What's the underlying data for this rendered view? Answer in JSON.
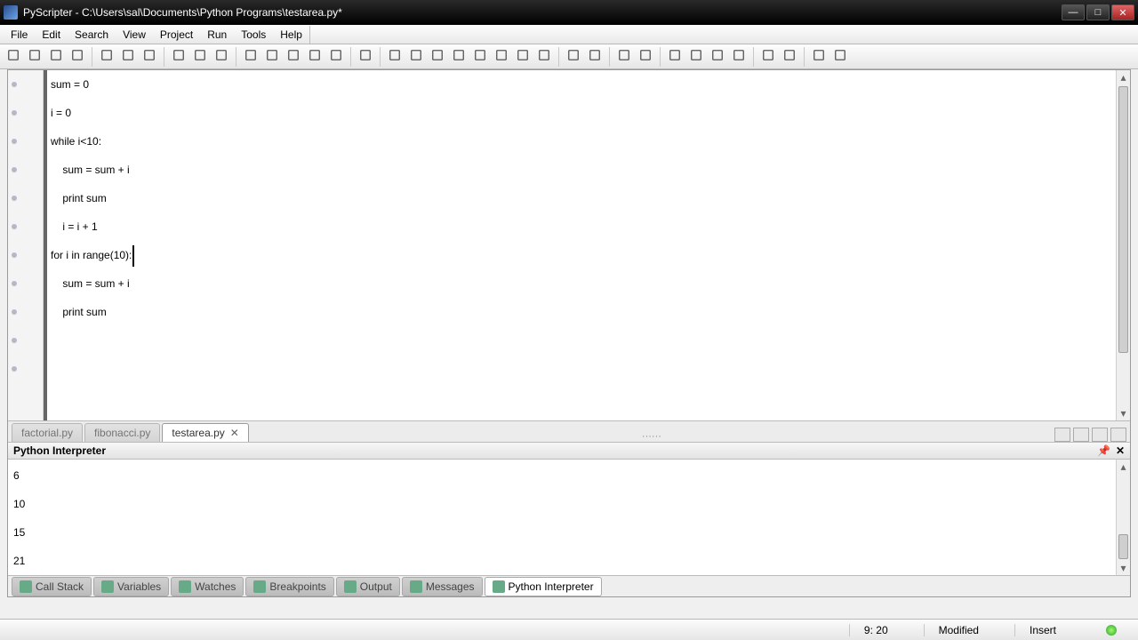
{
  "title": "PyScripter - C:\\Users\\sal\\Documents\\Python Programs\\testarea.py*",
  "menu": [
    "File",
    "Edit",
    "Search",
    "View",
    "Project",
    "Run",
    "Tools",
    "Help"
  ],
  "toolbar_icons": [
    "new-file",
    "open-file",
    "save",
    "save-all",
    "print",
    "cut",
    "copy",
    "paste",
    "reload",
    "stop-refresh",
    "find",
    "find-next",
    "find-highlight",
    "toggle-bookmark",
    "goto",
    "go-back",
    "run",
    "step-over",
    "step-into",
    "step-out",
    "run-to-cursor",
    "toggle-breakpoint",
    "pause",
    "stop",
    "hand",
    "world",
    "nav-back",
    "nav-fwd",
    "dedent",
    "indent",
    "comment",
    "line-numbers",
    "word-wrap",
    "whitespace",
    "options",
    "python-engine"
  ],
  "code_lines": [
    "",
    "sum = 0",
    "i = 0",
    "while i<10:",
    "    sum = sum + i",
    "    print sum",
    "    i = i + 1",
    "",
    "for i in range(10):",
    "    sum = sum + i",
    "    print sum"
  ],
  "cursor_line_index": 8,
  "editor_tabs": [
    {
      "label": "factorial.py",
      "active": false,
      "dim": true
    },
    {
      "label": "fibonacci.py",
      "active": false,
      "dim": true
    },
    {
      "label": "testarea.py",
      "active": true,
      "closable": true
    }
  ],
  "interp_title": "Python Interpreter",
  "interp_output": [
    "6",
    "10",
    "15",
    "21"
  ],
  "bottom_tabs": [
    {
      "label": "Call Stack",
      "icon": "stack"
    },
    {
      "label": "Variables",
      "icon": "vars"
    },
    {
      "label": "Watches",
      "icon": "watch"
    },
    {
      "label": "Breakpoints",
      "icon": "bp"
    },
    {
      "label": "Output",
      "icon": "out"
    },
    {
      "label": "Messages",
      "icon": "msg"
    },
    {
      "label": "Python Interpreter",
      "icon": "py",
      "active": true
    }
  ],
  "status": {
    "pos": "9: 20",
    "modified": "Modified",
    "mode": "Insert"
  }
}
